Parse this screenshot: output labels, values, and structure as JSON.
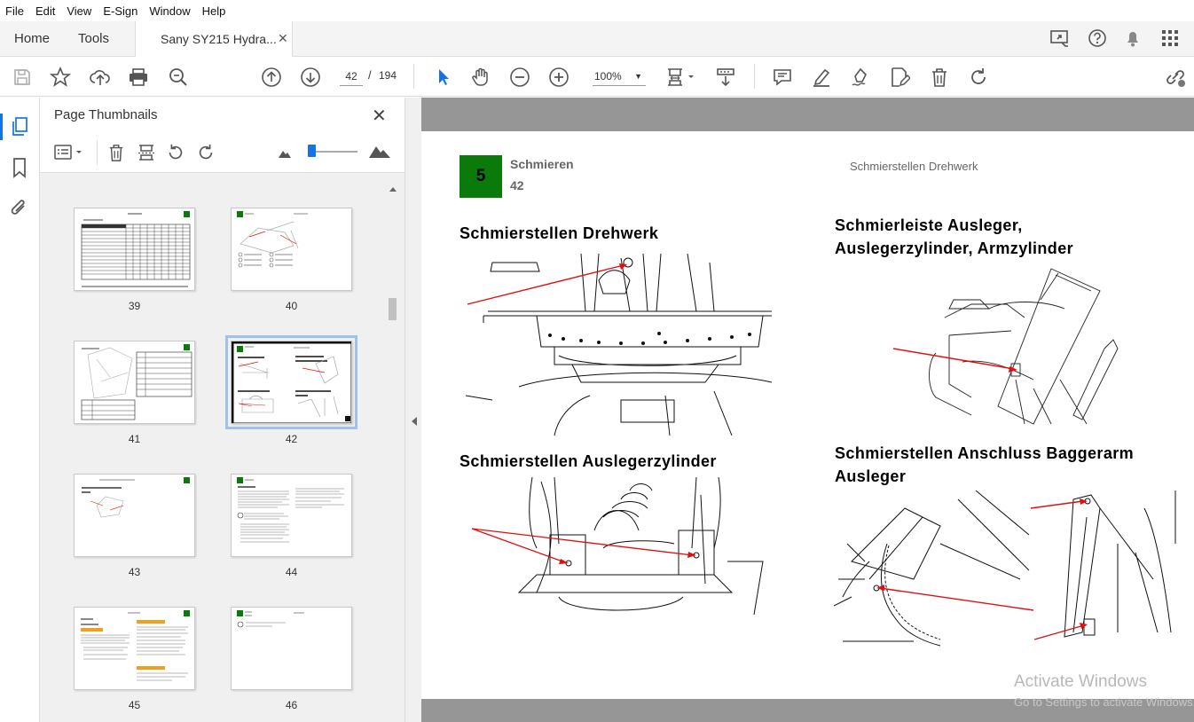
{
  "menu": [
    "File",
    "Edit",
    "View",
    "E-Sign",
    "Window",
    "Help"
  ],
  "tabs": {
    "home": "Home",
    "tools": "Tools",
    "document": "Sany SY215 Hydra...",
    "close": "✕"
  },
  "toolbar": {
    "current_page": "42",
    "separator": "/",
    "total_pages": "194",
    "zoom": "100%",
    "zoom_caret": "▼"
  },
  "panel": {
    "title": "Page Thumbnails",
    "close": "✕",
    "thumbnails": [
      {
        "label": "39"
      },
      {
        "label": "40"
      },
      {
        "label": "41"
      },
      {
        "label": "42",
        "selected": true
      },
      {
        "label": "43"
      },
      {
        "label": "44"
      },
      {
        "label": "45"
      },
      {
        "label": "46"
      }
    ]
  },
  "page": {
    "badge": "5",
    "section_title": "Schmieren",
    "section_number": "42",
    "running_header": "Schmierstellen Drehwerk",
    "headings": {
      "h1": "Schmierstellen Drehwerk",
      "h2_line1": "Schmierleiste Ausleger,",
      "h2_line2": "Auslegerzylinder, Armzylinder",
      "h3": "Schmierstellen Auslegerzylinder",
      "h4_line1": "Schmierstellen Anschluss Baggerarm",
      "h4_line2": "Ausleger"
    }
  },
  "watermark": {
    "line1": "Activate Windows",
    "line2": "Go to Settings to activate Windows."
  },
  "colors": {
    "accent": "#1473e6",
    "badge_green": "#0a7b0a",
    "arrow_red": "#e01010"
  }
}
